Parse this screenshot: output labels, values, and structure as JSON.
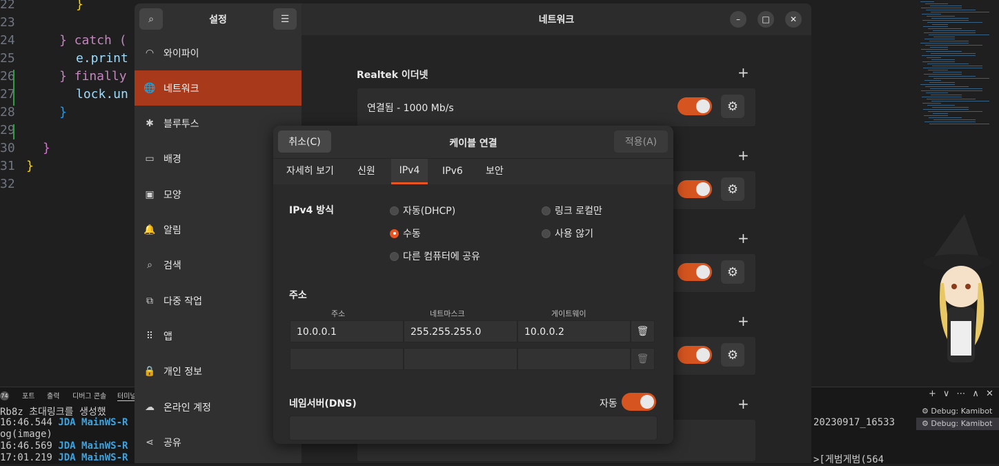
{
  "editor": {
    "line_numbers": [
      "22",
      "23",
      "24",
      "25",
      "26",
      "27",
      "28",
      "29",
      "30",
      "31",
      "32"
    ],
    "lines": [
      {
        "text": "}",
        "color": "#ffd700"
      },
      {
        "text": "",
        "color": "#ccc"
      },
      {
        "text": "} catch (",
        "color": "#c586c0"
      },
      {
        "text": "e.print",
        "color": "#9cdcfe"
      },
      {
        "text": "} finally",
        "color": "#c586c0"
      },
      {
        "text": "lock.un",
        "color": "#9cdcfe"
      },
      {
        "text": "}",
        "color": "#179fff"
      },
      {
        "text": "",
        "color": "#ccc"
      },
      {
        "text": "}",
        "color": "#da70d6"
      },
      {
        "text": "}",
        "color": "#ffd700"
      },
      {
        "text": "",
        "color": "#ccc"
      }
    ]
  },
  "terminal_panel": {
    "badge": "74",
    "tabs": [
      "포트",
      "출력",
      "디버그 콘솔",
      "터미널"
    ],
    "lines": [
      "Rb8z 초대링크를 생성했",
      "16:46.544 JDA MainWS-R",
      "og(image)",
      "16:46.569 JDA MainWS-R",
      "17:01.219 JDA MainWS-R"
    ],
    "right_lines": [
      "20230917_16533",
      ">[게범게범(564"
    ],
    "toolbar": [
      "+",
      "∨",
      "⋯",
      "∧",
      "✕"
    ],
    "debug_items": [
      "Debug: Kamibot",
      "Debug: Kamibot"
    ]
  },
  "settings": {
    "sidebar_title": "설정",
    "search_icon": "search-icon",
    "menu_icon": "hamburger-icon",
    "items": [
      {
        "label": "와이파이",
        "icon": "wifi-icon",
        "glyph": "◠"
      },
      {
        "label": "네트워크",
        "icon": "globe-icon",
        "glyph": "🌐"
      },
      {
        "label": "블루투스",
        "icon": "bluetooth-icon",
        "glyph": "✱"
      },
      {
        "label": "배경",
        "icon": "monitor-icon",
        "glyph": "▭"
      },
      {
        "label": "모양",
        "icon": "appearance-icon",
        "glyph": "▣"
      },
      {
        "label": "알림",
        "icon": "bell-icon",
        "glyph": "🔔"
      },
      {
        "label": "검색",
        "icon": "search-icon",
        "glyph": "⌕"
      },
      {
        "label": "다중 작업",
        "icon": "multitask-icon",
        "glyph": "⧉"
      },
      {
        "label": "앱",
        "icon": "apps-grid-icon",
        "glyph": "⠿"
      },
      {
        "label": "개인 정보",
        "icon": "lock-icon",
        "glyph": "🔒"
      },
      {
        "label": "온라인 계정",
        "icon": "cloud-icon",
        "glyph": "☁"
      },
      {
        "label": "공유",
        "icon": "share-icon",
        "glyph": "⋖"
      }
    ],
    "active_index": 1,
    "header_title": "네트워크",
    "window_buttons": [
      "–",
      "□",
      "✕"
    ],
    "ethernet_section": "Realtek 이더넷",
    "ethernet_status": "연결됨 - 1000 Mb/s",
    "accent": "#e95420"
  },
  "dialog": {
    "cancel": "취소(C)",
    "title": "케이블 연결",
    "apply": "적용(A)",
    "tabs": [
      "자세히 보기",
      "신원",
      "IPv4",
      "IPv6",
      "보안"
    ],
    "active_tab": "IPv4",
    "method_label": "IPv4 방식",
    "methods": [
      {
        "label": "자동(DHCP)",
        "selected": false
      },
      {
        "label": "링크 로컬만",
        "selected": false
      },
      {
        "label": "수동",
        "selected": true
      },
      {
        "label": "사용 않기",
        "selected": false
      },
      {
        "label": "다른 컴퓨터에 공유",
        "selected": false
      }
    ],
    "address_label": "주소",
    "columns": [
      "주소",
      "네트마스크",
      "게이트웨이"
    ],
    "rows": [
      {
        "address": "10.0.0.1",
        "netmask": "255.255.255.0",
        "gateway": "10.0.0.2"
      },
      {
        "address": "",
        "netmask": "",
        "gateway": ""
      }
    ],
    "dns_label": "네임서버(DNS)",
    "dns_auto_label": "자동",
    "dns_auto": true,
    "dns_value": ""
  }
}
